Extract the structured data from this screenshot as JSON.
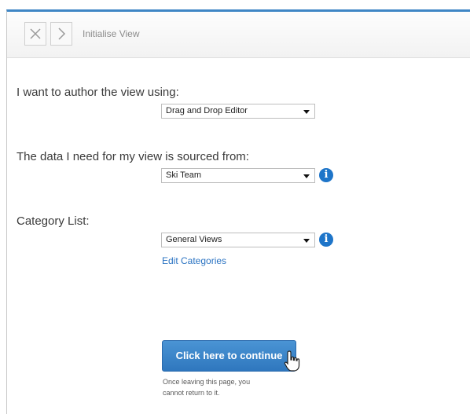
{
  "header": {
    "close_icon": "close-icon",
    "next_icon": "chevron-right-icon",
    "title": "Initialise View"
  },
  "author": {
    "label": "I want to author the view using:",
    "selected": "Drag and Drop Editor"
  },
  "source": {
    "label": "The data I need for my view is sourced from:",
    "selected": "Ski Team"
  },
  "category": {
    "label": "Category List:",
    "selected": "General Views",
    "edit_link": "Edit Categories"
  },
  "continue_button": {
    "label": "Click here to continue"
  },
  "note": "Once leaving this page, you cannot return to it.",
  "colors": {
    "accent": "#3f86c5",
    "button": "#3a84c9",
    "info": "#1e75c9",
    "link": "#2a73c2"
  }
}
